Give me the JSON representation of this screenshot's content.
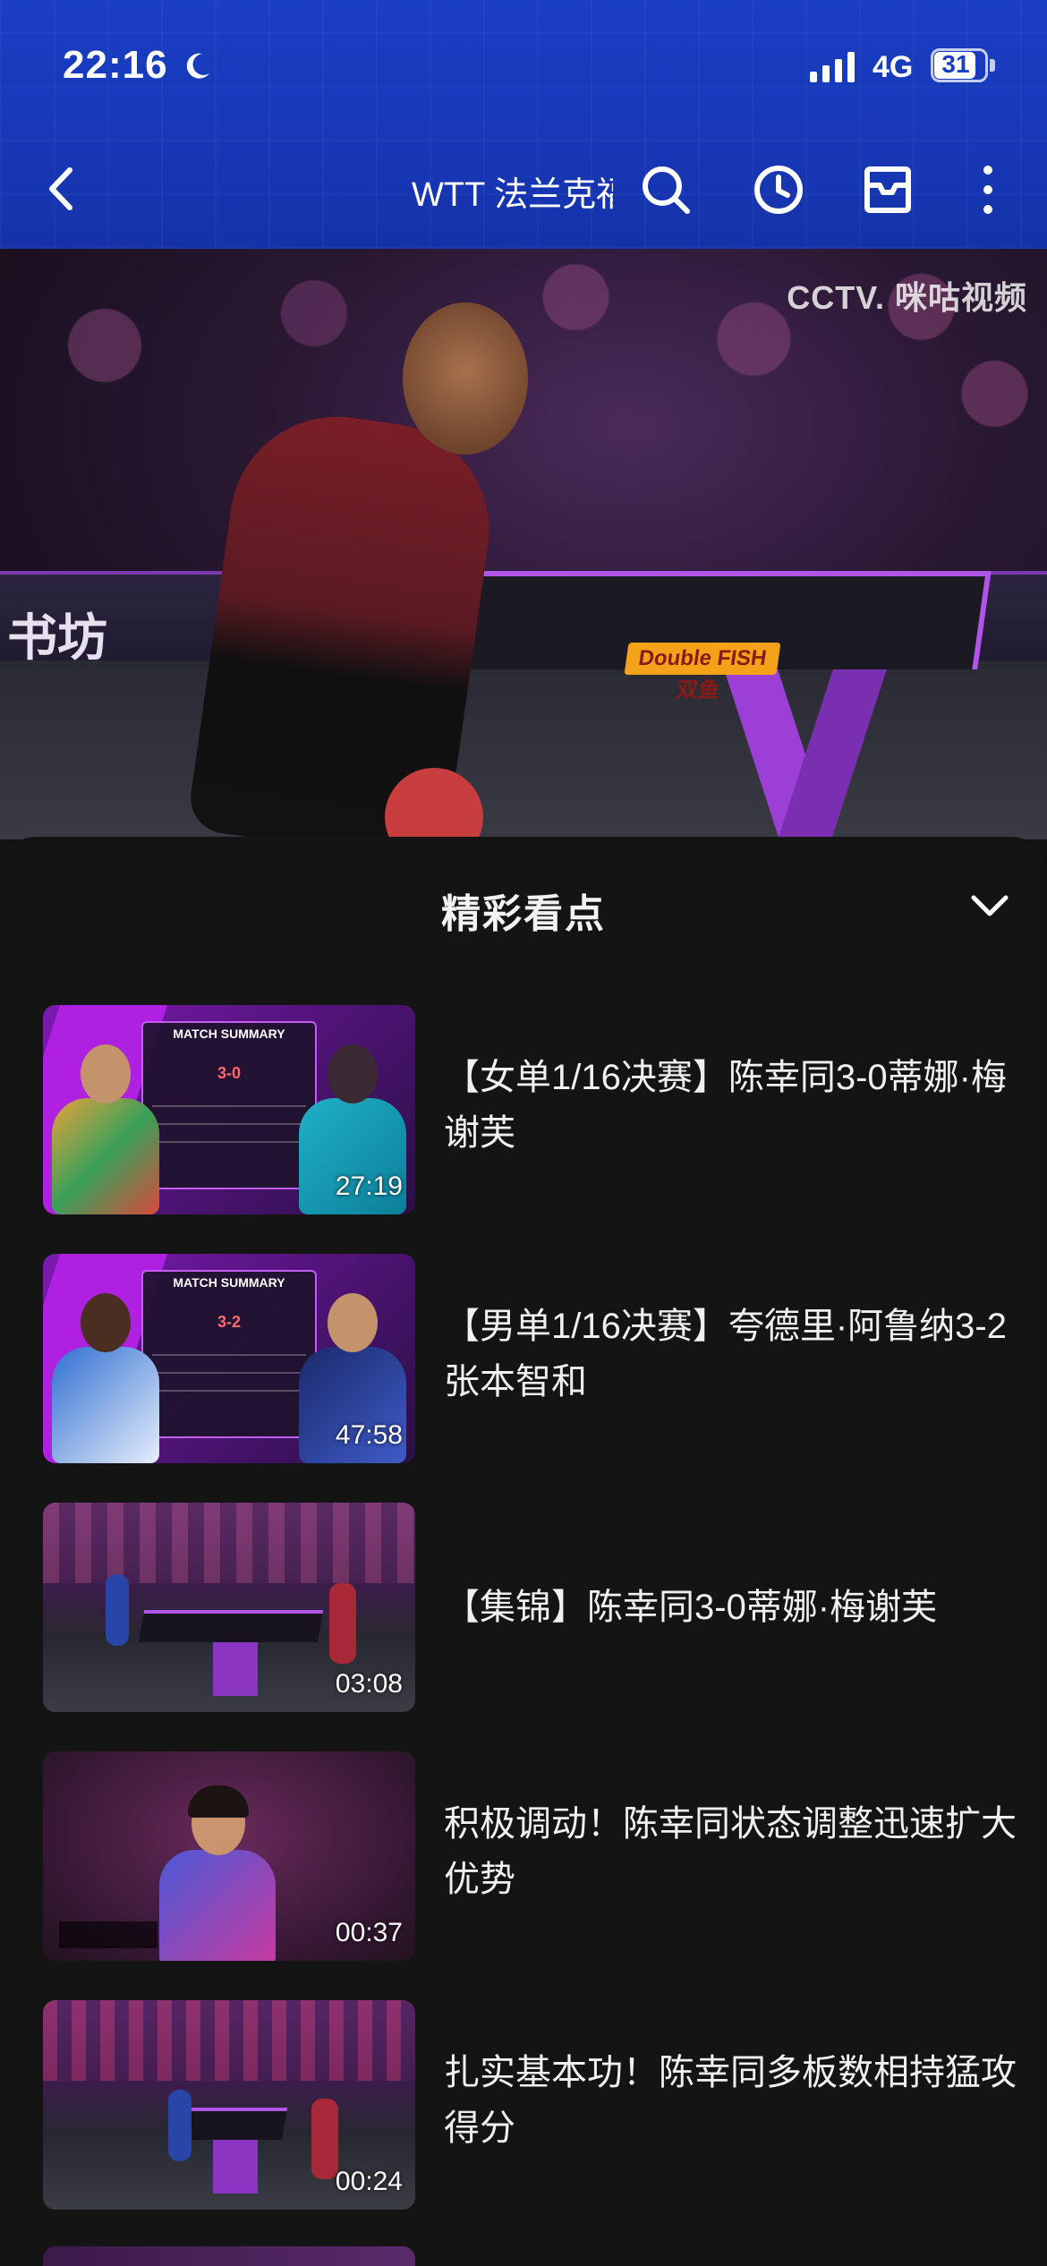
{
  "status_bar": {
    "time": "22:16",
    "network": "4G",
    "battery": "31"
  },
  "nav": {
    "title": "WTT 法兰克福",
    "icons": [
      "back-icon",
      "search-icon",
      "history-icon",
      "inbox-icon",
      "more-icon"
    ]
  },
  "video": {
    "watermark": "CCTV. 咪咕视频",
    "barrier_text": "书坊",
    "brand_badge": "Double FISH 双鱼"
  },
  "sheet": {
    "title": "精彩看点",
    "items": [
      {
        "title": "【女单1/16决赛】陈幸同3-0蒂娜·梅谢芙",
        "duration": "27:19",
        "thumb": "match-summary",
        "thumb_heading": "MATCH SUMMARY",
        "thumb_score": "3-0"
      },
      {
        "title": "【男单1/16决赛】夸德里·阿鲁纳3-2张本智和",
        "duration": "47:58",
        "thumb": "match-summary",
        "thumb_heading": "MATCH SUMMARY",
        "thumb_score": "3-2"
      },
      {
        "title": "【集锦】陈幸同3-0蒂娜·梅谢芙",
        "duration": "03:08",
        "thumb": "arena"
      },
      {
        "title": "积极调动！陈幸同状态调整迅速扩大优势",
        "duration": "00:37",
        "thumb": "portrait"
      },
      {
        "title": "扎实基本功！陈幸同多板数相持猛攻得分",
        "duration": "00:24",
        "thumb": "arena"
      }
    ]
  },
  "colors": {
    "header_blue": "#1a3ec4",
    "sheet_bg": "#141414",
    "accent_purple": "#b055e8"
  }
}
